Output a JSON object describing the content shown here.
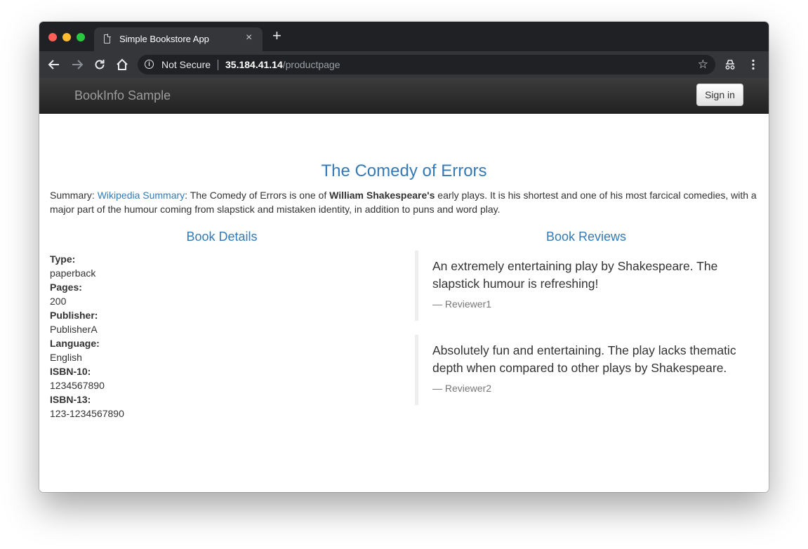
{
  "browser": {
    "tab_title": "Simple Bookstore App",
    "tab_close": "×",
    "new_tab": "+",
    "security_label": "Not Secure",
    "url_host": "35.184.41.14",
    "url_path": "/productpage"
  },
  "navbar": {
    "brand": "BookInfo Sample",
    "signin_label": "Sign in"
  },
  "product": {
    "title": "The Comedy of Errors",
    "summary_prefix": "Summary: ",
    "summary_link": "Wikipedia Summary",
    "summary_mid": ": The Comedy of Errors is one of ",
    "summary_author": "William Shakespeare's",
    "summary_rest": " early plays. It is his shortest and one of his most farcical comedies, with a major part of the humour coming from slapstick and mistaken identity, in addition to puns and word play."
  },
  "details": {
    "heading": "Book Details",
    "items": [
      {
        "label": "Type:",
        "value": "paperback"
      },
      {
        "label": "Pages:",
        "value": "200"
      },
      {
        "label": "Publisher:",
        "value": "PublisherA"
      },
      {
        "label": "Language:",
        "value": "English"
      },
      {
        "label": "ISBN-10:",
        "value": "1234567890"
      },
      {
        "label": "ISBN-13:",
        "value": "123-1234567890"
      }
    ]
  },
  "reviews": {
    "heading": "Book Reviews",
    "items": [
      {
        "text": "An extremely entertaining play by Shakespeare. The slapstick humour is refreshing!",
        "reviewer": "— Reviewer1"
      },
      {
        "text": "Absolutely fun and entertaining. The play lacks thematic depth when compared to other plays by Shakespeare.",
        "reviewer": "— Reviewer2"
      }
    ]
  }
}
